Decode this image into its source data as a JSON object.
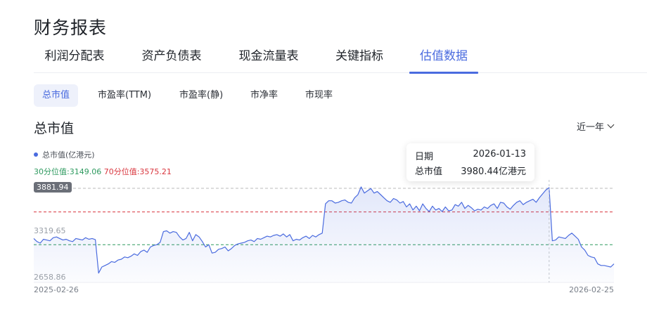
{
  "page": {
    "title": "财务报表"
  },
  "tabs": [
    {
      "label": "利润分配表"
    },
    {
      "label": "资产负债表"
    },
    {
      "label": "现金流量表"
    },
    {
      "label": "关键指标"
    },
    {
      "label": "估值数据",
      "active": true
    }
  ],
  "subtabs": [
    {
      "label": "总市值",
      "active": true
    },
    {
      "label": "市盈率(TTM)"
    },
    {
      "label": "市盈率(静)"
    },
    {
      "label": "市净率"
    },
    {
      "label": "市现率"
    }
  ],
  "section": {
    "title": "总市值",
    "range": "近一年"
  },
  "legend": {
    "series": "总市值(亿港元)",
    "p30_label": "30分位值:",
    "p30_value": "3149.06",
    "p70_label": "70分位值:",
    "p70_value": "3575.21"
  },
  "tooltip": {
    "date_label": "日期",
    "date": "2026-01-13",
    "value_label": "总市值",
    "value": "3980.44亿港元"
  },
  "colors": {
    "accent": "#4a6bdf",
    "line": "#4a6bdf",
    "p30": "#2e9a5f",
    "p70": "#d9363e",
    "max": "#bbbbbb"
  },
  "chart_data": {
    "type": "area",
    "series": [
      {
        "name": "总市值(亿港元)"
      }
    ],
    "x_start": "2025-02-26",
    "x_end": "2026-02-25",
    "y_labels": {
      "max": "3881.94",
      "mid": "3319.65",
      "min": "2658.86"
    },
    "ylim": [
      2658.86,
      3881.94
    ],
    "reference_lines": {
      "max": 3881.94,
      "p70": 3575.21,
      "p30": 3149.06
    },
    "highlight": {
      "date": "2026-01-13",
      "value": 3980.44
    },
    "values": [
      3230,
      3190,
      3170,
      3220,
      3210,
      3200,
      3240,
      3250,
      3230,
      3210,
      3220,
      3200,
      3190,
      3230,
      3220,
      3210,
      3240,
      3220,
      3230,
      3215,
      2780,
      2860,
      2880,
      2900,
      2930,
      2920,
      2950,
      2960,
      2990,
      2980,
      3000,
      3030,
      3010,
      3060,
      3080,
      3050,
      3120,
      3140,
      3150,
      3180,
      3320,
      3330,
      3300,
      3320,
      3310,
      3250,
      3210,
      3230,
      3310,
      3200,
      3280,
      3250,
      3190,
      3120,
      3150,
      3040,
      3050,
      3090,
      3100,
      3120,
      3070,
      3100,
      3140,
      3160,
      3170,
      3180,
      3200,
      3210,
      3190,
      3230,
      3220,
      3240,
      3260,
      3250,
      3270,
      3280,
      3260,
      3290,
      3250,
      3280,
      3200,
      3220,
      3210,
      3240,
      3260,
      3230,
      3270,
      3250,
      3280,
      3300,
      3680,
      3720,
      3720,
      3690,
      3700,
      3720,
      3730,
      3700,
      3690,
      3760,
      3800,
      3900,
      3820,
      3850,
      3880,
      3820,
      3840,
      3800,
      3760,
      3720,
      3700,
      3750,
      3730,
      3690,
      3710,
      3640,
      3680,
      3600,
      3650,
      3590,
      3680,
      3620,
      3580,
      3650,
      3600,
      3620,
      3580,
      3640,
      3590,
      3600,
      3670,
      3650,
      3700,
      3620,
      3660,
      3630,
      3590,
      3610,
      3600,
      3640,
      3620,
      3660,
      3680,
      3620,
      3700,
      3690,
      3640,
      3610,
      3660,
      3700,
      3720,
      3670,
      3700,
      3720,
      3740,
      3700,
      3760,
      3810,
      3860,
      3890,
      3200,
      3210,
      3250,
      3240,
      3230,
      3270,
      3300,
      3260,
      3220,
      3120,
      3080,
      3010,
      2990,
      2980,
      2900,
      2880,
      2880,
      2870,
      2860,
      2900
    ]
  }
}
